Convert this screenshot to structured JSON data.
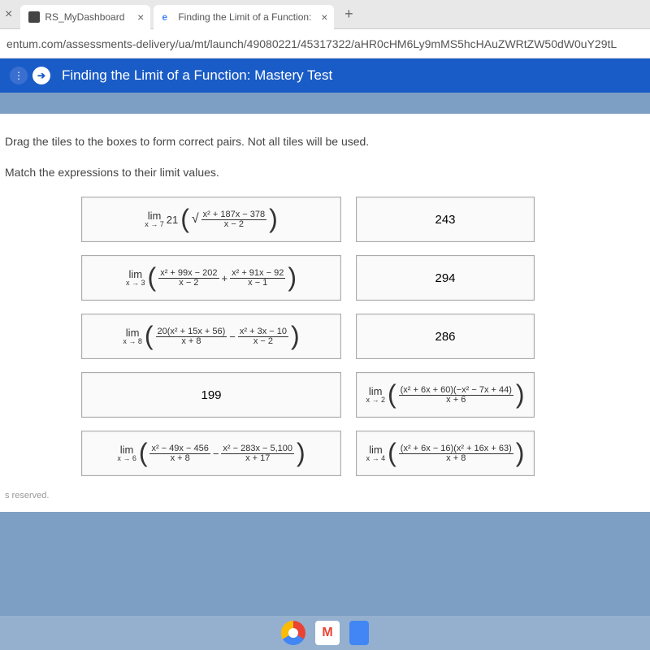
{
  "tabs": {
    "t1": {
      "label": "RS_MyDashboard"
    },
    "t2": {
      "label": "Finding the Limit of a Function:"
    },
    "fav_e": "e"
  },
  "new_tab": "+",
  "close": "×",
  "address": "entum.com/assessments-delivery/ua/mt/launch/49080221/45317322/aHR0cHM6Ly9mMS5hcHAuZWRtZW50dW0uY29tL",
  "hdr": {
    "arrow": "➔",
    "title": "Finding the Limit of a Function: Mastery Test"
  },
  "instr1": "Drag the tiles to the boxes to form correct pairs. Not all tiles will be used.",
  "instr2": "Match the expressions to their limit values.",
  "vals": {
    "a": "243",
    "b": "294",
    "c": "286",
    "d": "199"
  },
  "m": {
    "lim": "lim",
    "to7": "x → 7",
    "to3": "x → 3",
    "to8": "x → 8",
    "to6": "x → 6",
    "to2": "x → 2",
    "to4": "x → 4",
    "c21": "21",
    "e1n": "x² + 187x − 378",
    "e1d": "x − 2",
    "e2an": "x² + 99x − 202",
    "e2ad": "x − 2",
    "e2bn": "x² + 91x − 92",
    "e2bd": "x − 1",
    "e3an": "20(x² + 15x + 56)",
    "e3ad": "x + 8",
    "e3bn": "x² + 3x − 10",
    "e3bd": "x − 2",
    "e5an": "x² − 49x − 456",
    "e5ad": "x + 8",
    "e5bn": "x² − 283x − 5,100",
    "e5bd": "x + 17",
    "e6n": "(x² + 6x + 60)(−x² − 7x + 44)",
    "e6d": "x + 6",
    "e7n": "(x² + 6x − 16)(x² + 16x + 63)",
    "e7d": "x + 8",
    "plus": "+",
    "minus": "−"
  },
  "footer": "s reserved.",
  "dock": {
    "gmail": "M"
  }
}
